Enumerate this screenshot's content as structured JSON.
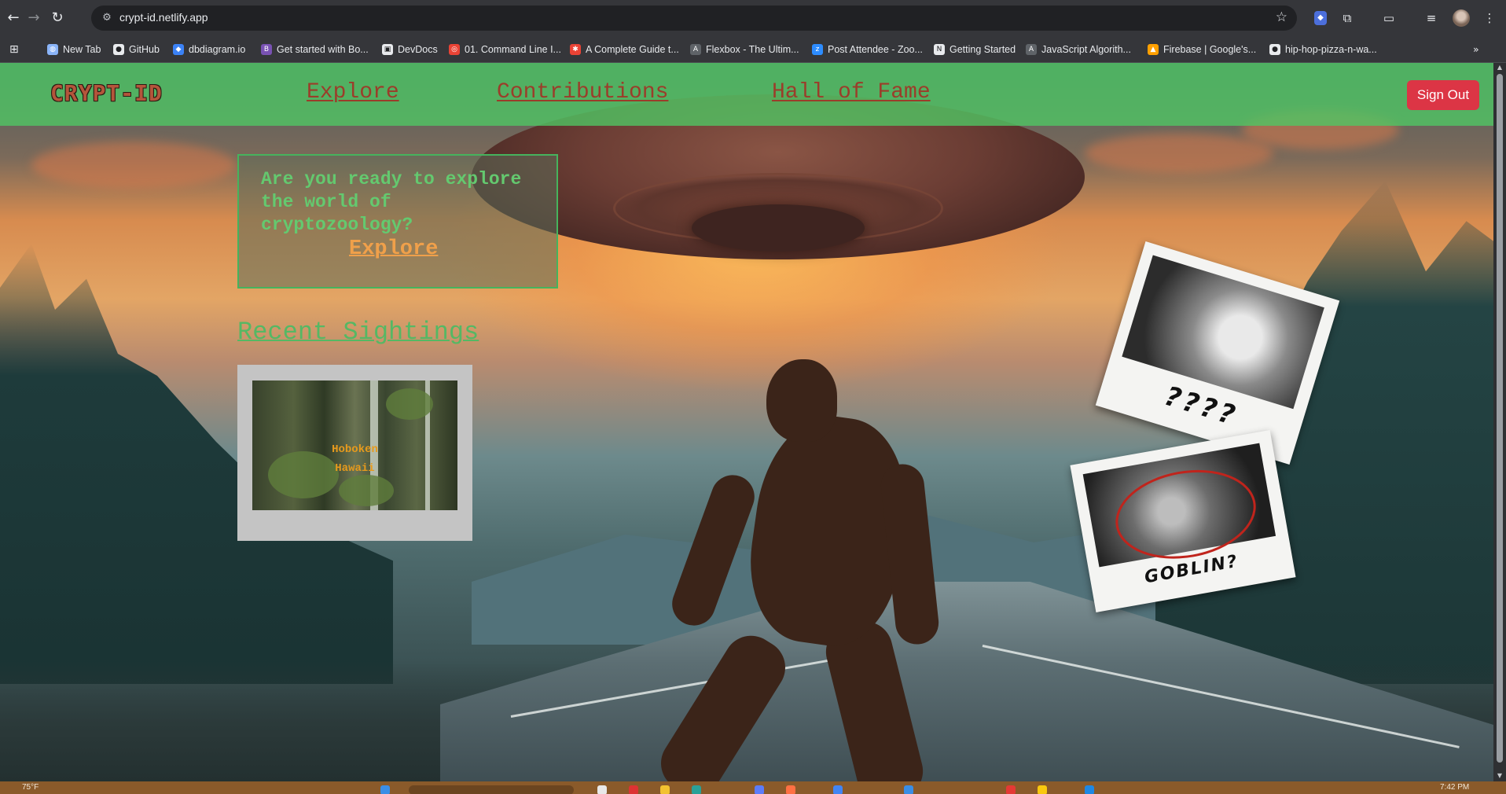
{
  "browser": {
    "url": "crypt-id.netlify.app",
    "nav": {
      "back_icon": "arrow-left",
      "forward_icon": "arrow-right",
      "reload_icon": "reload"
    },
    "bookmarks": [
      {
        "label": "New Tab",
        "icon": "globe-icon",
        "color": "#8ab4f8"
      },
      {
        "label": "GitHub",
        "icon": "github-icon",
        "color": "#e8eaed"
      },
      {
        "label": "dbdiagram.io",
        "icon": "dbdiagram-icon",
        "color": "#3b82f6"
      },
      {
        "label": "Get started with Bo...",
        "icon": "bootstrap-icon",
        "color": "#7952b3"
      },
      {
        "label": "DevDocs",
        "icon": "devdocs-icon",
        "color": "#e8eaed"
      },
      {
        "label": "01. Command Line I...",
        "icon": "course-icon",
        "color": "#ea4335"
      },
      {
        "label": "A Complete Guide t...",
        "icon": "csstricks-icon",
        "color": "#ea4335"
      },
      {
        "label": "Flexbox - The Ultim...",
        "icon": "a-icon",
        "color": "#5f6368"
      },
      {
        "label": "Post Attendee - Zoo...",
        "icon": "zoom-icon",
        "color": "#2d8cff"
      },
      {
        "label": "Getting Started",
        "icon": "notion-icon",
        "color": "#e8eaed"
      },
      {
        "label": "JavaScript Algorith...",
        "icon": "a-icon",
        "color": "#5f6368"
      },
      {
        "label": "Firebase | Google's...",
        "icon": "firebase-icon",
        "color": "#ffa000"
      },
      {
        "label": "hip-hop-pizza-n-wa...",
        "icon": "github-icon",
        "color": "#e8eaed"
      }
    ],
    "overflow_icon": "chevron-double-right"
  },
  "site": {
    "logo": "CRYPT-ID",
    "nav_links": [
      "Explore",
      "Contributions",
      "Hall of Fame"
    ],
    "sign_out": "Sign Out",
    "hero": {
      "text": "Are you ready to explore the world of cryptozoology?",
      "link": "Explore"
    },
    "recent_title": "Recent Sightings",
    "sightings": [
      {
        "line1": "Hoboken",
        "line2": "Hawaii"
      }
    ],
    "polaroids": [
      {
        "caption": "????"
      },
      {
        "caption": "GOBLIN?"
      }
    ]
  },
  "taskbar": {
    "weather": "75°F",
    "time": "7:42 PM"
  },
  "colors": {
    "navbar": "#50c864",
    "nav_link": "#9b3d2a",
    "sign_out": "#dc3545",
    "hero_text": "#64c96f",
    "hero_link": "#f0a04a",
    "recent_title": "#55b864"
  }
}
